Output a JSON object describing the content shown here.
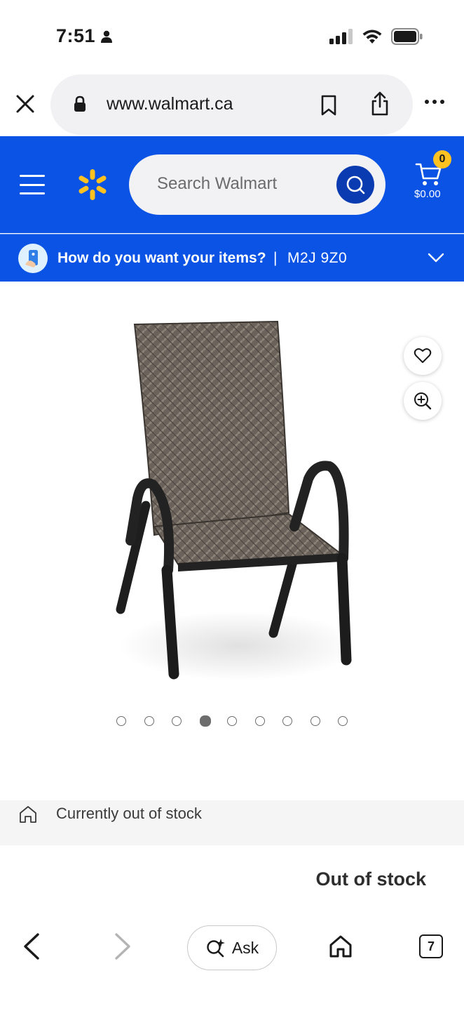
{
  "status_bar": {
    "time": "7:51"
  },
  "browser": {
    "url": "www.walmart.ca",
    "icons": [
      "close-icon",
      "lock-icon",
      "bookmark-icon",
      "share-icon",
      "more-icon"
    ]
  },
  "header": {
    "search_placeholder": "Search Walmart",
    "cart_count": "0",
    "cart_total": "$0.00",
    "colors": {
      "brand_blue": "#0a53e4",
      "spark_yellow": "#ffc220"
    }
  },
  "delivery": {
    "question": "How do you want your items?",
    "separator": "|",
    "postal_code": "M2J 9Z0"
  },
  "product": {
    "image_alt": "Patio stacking chair with wicker seat and black frame",
    "carousel": {
      "total": 9,
      "active_index": 3
    }
  },
  "stock": {
    "strip_text": "Currently out of stock",
    "status_label": "Out of stock"
  },
  "toolbar": {
    "ask_label": "Ask",
    "tab_count": "7"
  }
}
